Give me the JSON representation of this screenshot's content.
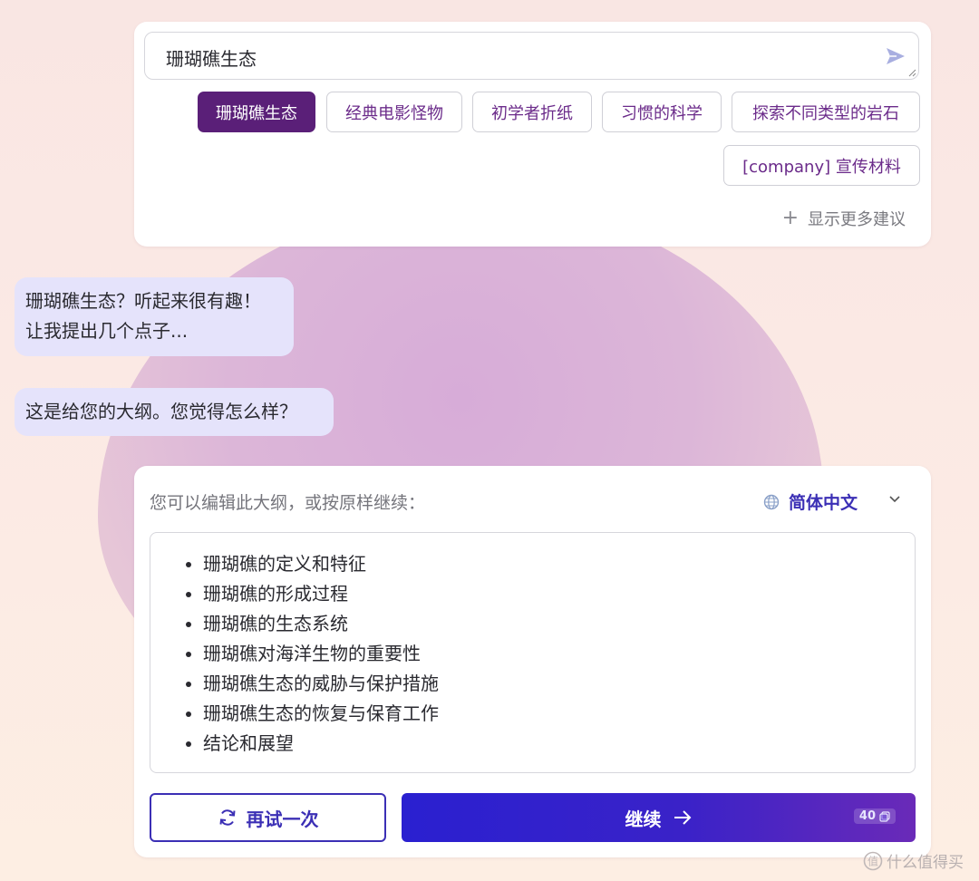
{
  "prompt": {
    "value": "珊瑚礁生态"
  },
  "suggestions": [
    {
      "label": "珊瑚礁生态",
      "active": true
    },
    {
      "label": "经典电影怪物",
      "active": false
    },
    {
      "label": "初学者折纸",
      "active": false
    },
    {
      "label": "习惯的科学",
      "active": false
    },
    {
      "label": "探索不同类型的岩石",
      "active": false
    },
    {
      "label": "[company] 宣传材料",
      "active": false
    }
  ],
  "show_more_label": "显示更多建议",
  "chat": {
    "message_1_line_1": "珊瑚礁生态？听起来很有趣！",
    "message_1_line_2": "让我提出几个点子...",
    "message_2": "这是给您的大纲。您觉得怎么样？"
  },
  "outline": {
    "hint": "您可以编辑此大纲，或按原样继续：",
    "language": "简体中文",
    "items": [
      "珊瑚礁的定义和特征",
      "珊瑚礁的形成过程",
      "珊瑚礁的生态系统",
      "珊瑚礁对海洋生物的重要性",
      "珊瑚礁生态的威胁与保护措施",
      "珊瑚礁生态的恢复与保育工作",
      "结论和展望"
    ]
  },
  "actions": {
    "retry_label": "再试一次",
    "continue_label": "继续",
    "credit_count": "40"
  },
  "watermark": "什么值得买",
  "colors": {
    "primary": "#3b2fb5",
    "chip_active": "#5a1f78",
    "chip_text": "#6b2b8a",
    "bubble": "#e5e3fb"
  },
  "icons": [
    "send-icon",
    "plus-icon",
    "globe-icon",
    "chevron-down-icon",
    "refresh-icon",
    "arrow-right-icon",
    "credit-icon"
  ]
}
